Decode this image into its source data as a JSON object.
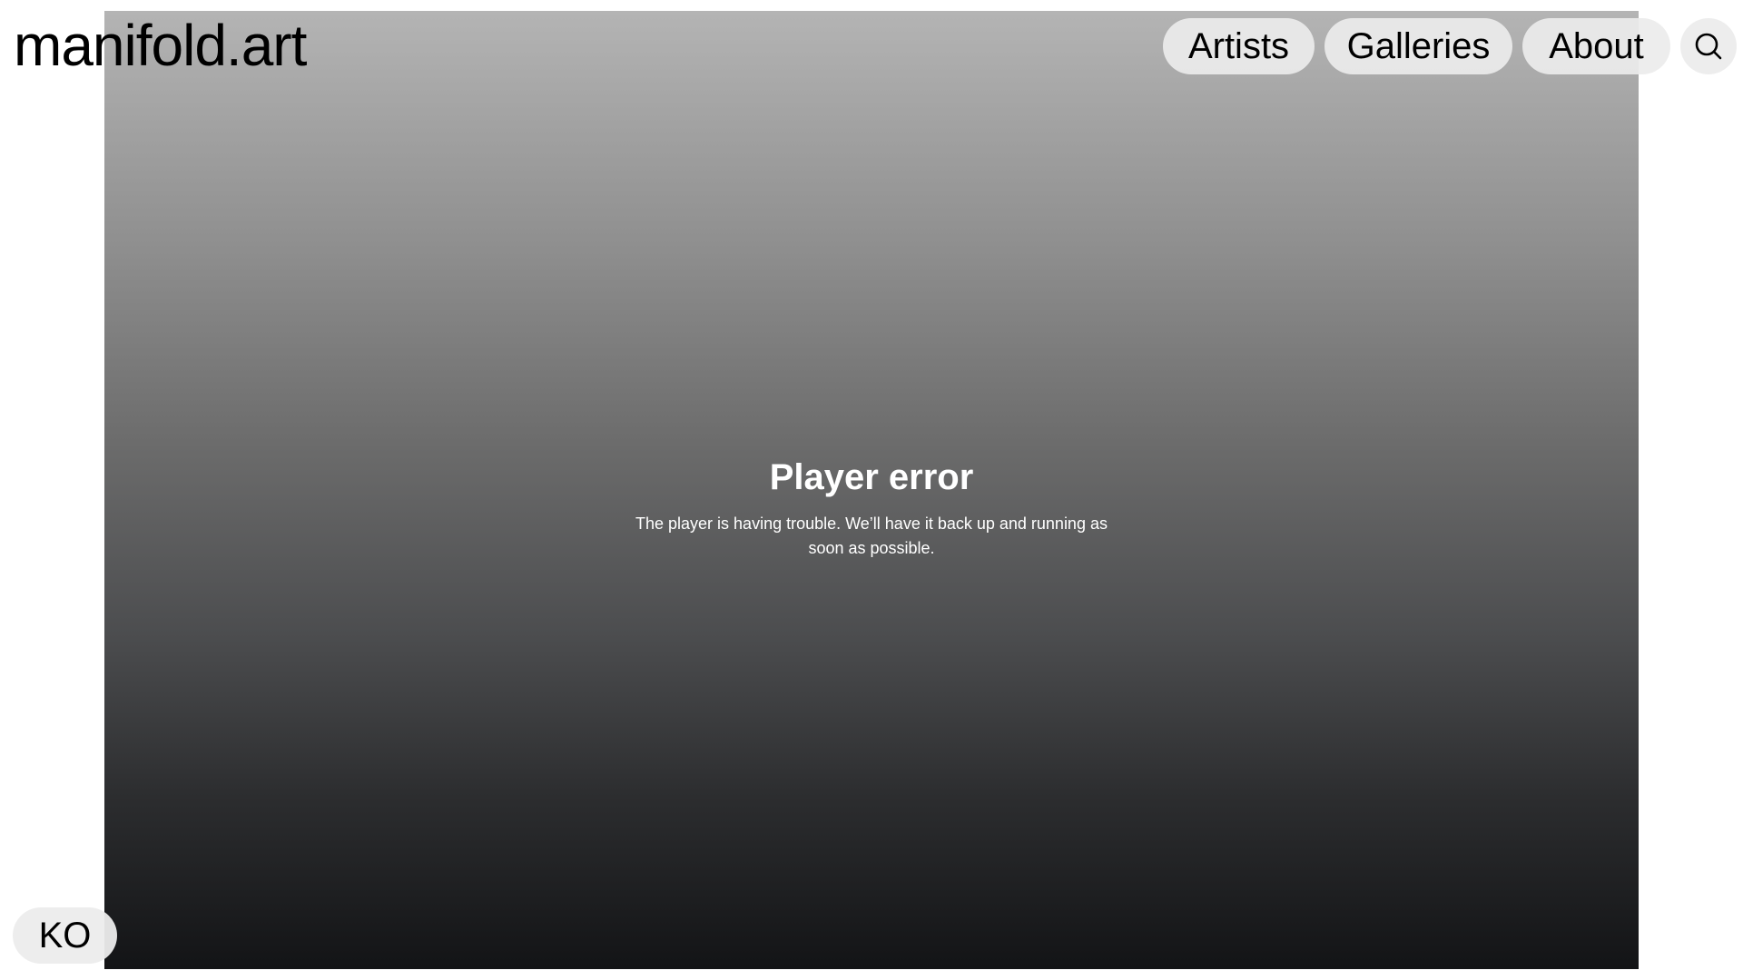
{
  "site": {
    "logo": "manifold.art"
  },
  "nav": {
    "items": [
      {
        "label": "Artists"
      },
      {
        "label": "Galleries"
      },
      {
        "label": "About"
      }
    ],
    "search_icon": "search-icon"
  },
  "player": {
    "title": "Player error",
    "description": "The player is having trouble. We’ll have it back up and running as soon as possible.",
    "close_icon": "close-icon"
  },
  "language": {
    "label": "KO"
  },
  "colors": {
    "gradient_top": "#b4b4b4",
    "gradient_bottom": "#131416",
    "pill_bg": "#ececec",
    "text": "#000000"
  }
}
